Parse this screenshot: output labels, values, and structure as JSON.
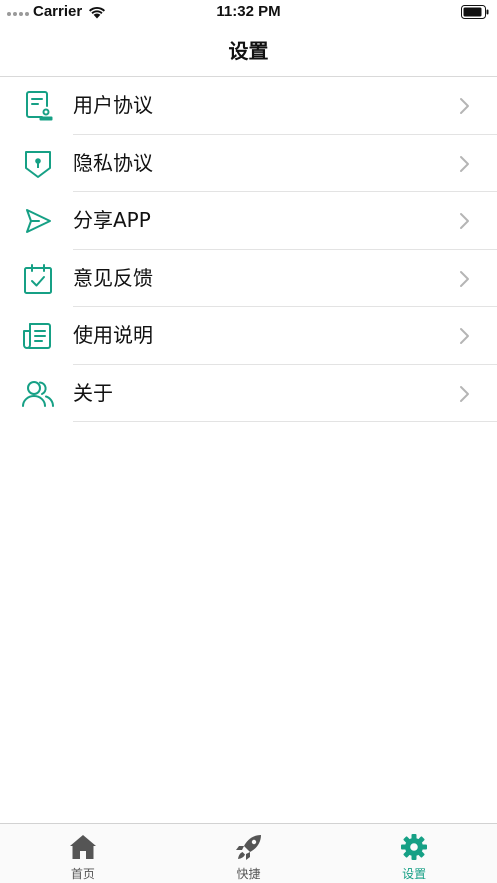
{
  "status_bar": {
    "carrier": "Carrier",
    "time": "11:32 PM"
  },
  "nav": {
    "title": "设置"
  },
  "settings": {
    "items": [
      {
        "label": "用户协议",
        "icon": "document-user-icon"
      },
      {
        "label": "隐私协议",
        "icon": "shield-lock-icon"
      },
      {
        "label": "分享APP",
        "icon": "send-icon"
      },
      {
        "label": "意见反馈",
        "icon": "calendar-check-icon"
      },
      {
        "label": "使用说明",
        "icon": "document-lines-icon"
      },
      {
        "label": "关于",
        "icon": "users-icon"
      }
    ]
  },
  "tab_bar": {
    "tabs": [
      {
        "label": "首页",
        "icon": "home-icon",
        "active": false
      },
      {
        "label": "快捷",
        "icon": "rocket-icon",
        "active": false
      },
      {
        "label": "设置",
        "icon": "gear-icon",
        "active": true
      }
    ]
  },
  "colors": {
    "accent": "#16a085",
    "icon_inactive": "#555555",
    "chevron": "#b5b5b5"
  }
}
